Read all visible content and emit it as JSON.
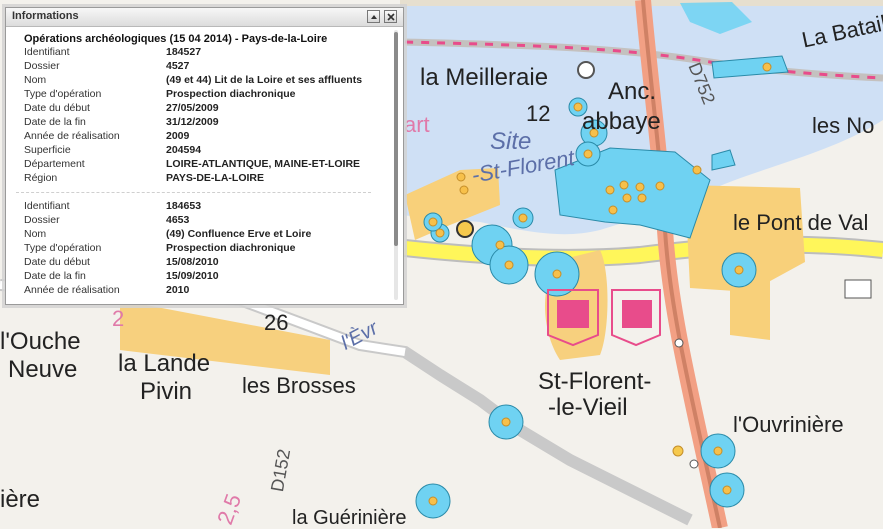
{
  "info_panel": {
    "title": "Informations",
    "records_header": "Opérations archéologiques (15 04 2014) - Pays-de-la-Loire",
    "records": [
      {
        "fields": [
          {
            "label": "Identifiant",
            "value": "184527"
          },
          {
            "label": "Dossier",
            "value": "4527"
          },
          {
            "label": "Nom",
            "value": "(49 et 44) Lit de la Loire et ses affluents"
          },
          {
            "label": "Type d'opération",
            "value": "Prospection diachronique"
          },
          {
            "label": "Date du début",
            "value": "27/05/2009"
          },
          {
            "label": "Date de la fin",
            "value": "31/12/2009"
          },
          {
            "label": "Année de réalisation",
            "value": "2009"
          },
          {
            "label": "Superficie",
            "value": "204594"
          },
          {
            "label": "Département",
            "value": "LOIRE-ATLANTIQUE, MAINE-ET-LOIRE"
          },
          {
            "label": "Région",
            "value": "PAYS-DE-LA-LOIRE"
          }
        ]
      },
      {
        "fields": [
          {
            "label": "Identifiant",
            "value": "184653"
          },
          {
            "label": "Dossier",
            "value": "4653"
          },
          {
            "label": "Nom",
            "value": "(49) Confluence Erve et Loire"
          },
          {
            "label": "Type d'opération",
            "value": "Prospection diachronique"
          },
          {
            "label": "Date du début",
            "value": "15/08/2010"
          },
          {
            "label": "Date de la fin",
            "value": "15/09/2010"
          },
          {
            "label": "Année de réalisation",
            "value": "2010"
          }
        ]
      }
    ]
  },
  "map": {
    "labels": {
      "la_meilleraie": "la Meilleraie",
      "anc": "Anc.",
      "abbaye": "abbaye",
      "site": "Site",
      "st_florent_top": "-St-Florent",
      "twelve": "12",
      "art": "art",
      "d752": "D752",
      "la_bataille": "La Bataille",
      "les_no": "les No",
      "le_pont_de_val": "le Pont de Val",
      "l_ouche": "l'Ouche",
      "neuve": "Neuve",
      "la_lande": "la Lande",
      "pivin": "Pivin",
      "les_brosses": "les Brosses",
      "st_florent": "St-Florent-",
      "le_vieil": "-le-Vieil",
      "l_ouvriniere": "l'Ouvrinière",
      "d152": "D152",
      "twenty_six": "26",
      "two_left": "2",
      "two_five": "2,5",
      "la_gueriniere": "la Guérinière",
      "iere": "ière",
      "evre": "l'Èvr"
    },
    "colors": {
      "water": "#cfe0f5",
      "site": "#f8d07a",
      "marker": "#6fd2f2",
      "road": "#e69d87",
      "highlight": "#e84c8b"
    }
  }
}
